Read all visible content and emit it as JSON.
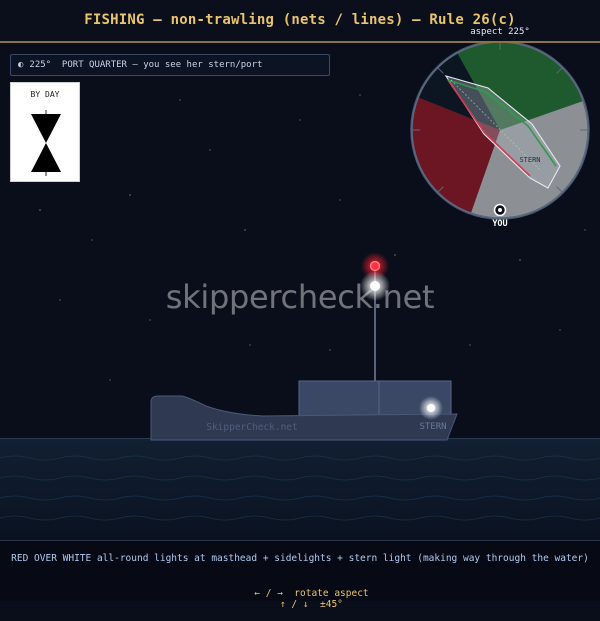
{
  "header": {
    "title": "FISHING — non-trawling (nets / lines) — Rule 26(c)",
    "aspect_label": "aspect 225°"
  },
  "aspect_info": {
    "icon": "half-circle-icon",
    "text": "225°  PORT QUARTER — you see her stern/port"
  },
  "day_shape": {
    "label": "BY DAY",
    "shape": "two cones apexes together (hourglass)"
  },
  "radar": {
    "aspect_degrees": 225,
    "sectors": {
      "port_color": "#8b1a2a",
      "starboard_color": "#1f6b34",
      "stern_color": "#9a9a9a"
    },
    "stern_label": "STERN",
    "you_label": "YOU"
  },
  "vessel": {
    "hull_name": "SkipperCheck.net",
    "stern_label": "STERN",
    "lights": {
      "masthead_top": "red",
      "masthead_bottom": "white",
      "stern": "white"
    }
  },
  "watermark": "skippercheck.net",
  "footer": {
    "description": "RED OVER WHITE all-round lights at masthead + sidelights + stern light (making way through the water)",
    "control_rotate": "← / →  rotate aspect",
    "control_step": "↑ / ↓  ±45°"
  },
  "colors": {
    "title": "#e9c46a",
    "sky": "#0a0e1a",
    "sea": "#0f1a28",
    "hull": "#2f3a52",
    "cabin": "#3a4866",
    "red_light": "#ff2a3a",
    "white_light": "#ffffff"
  }
}
